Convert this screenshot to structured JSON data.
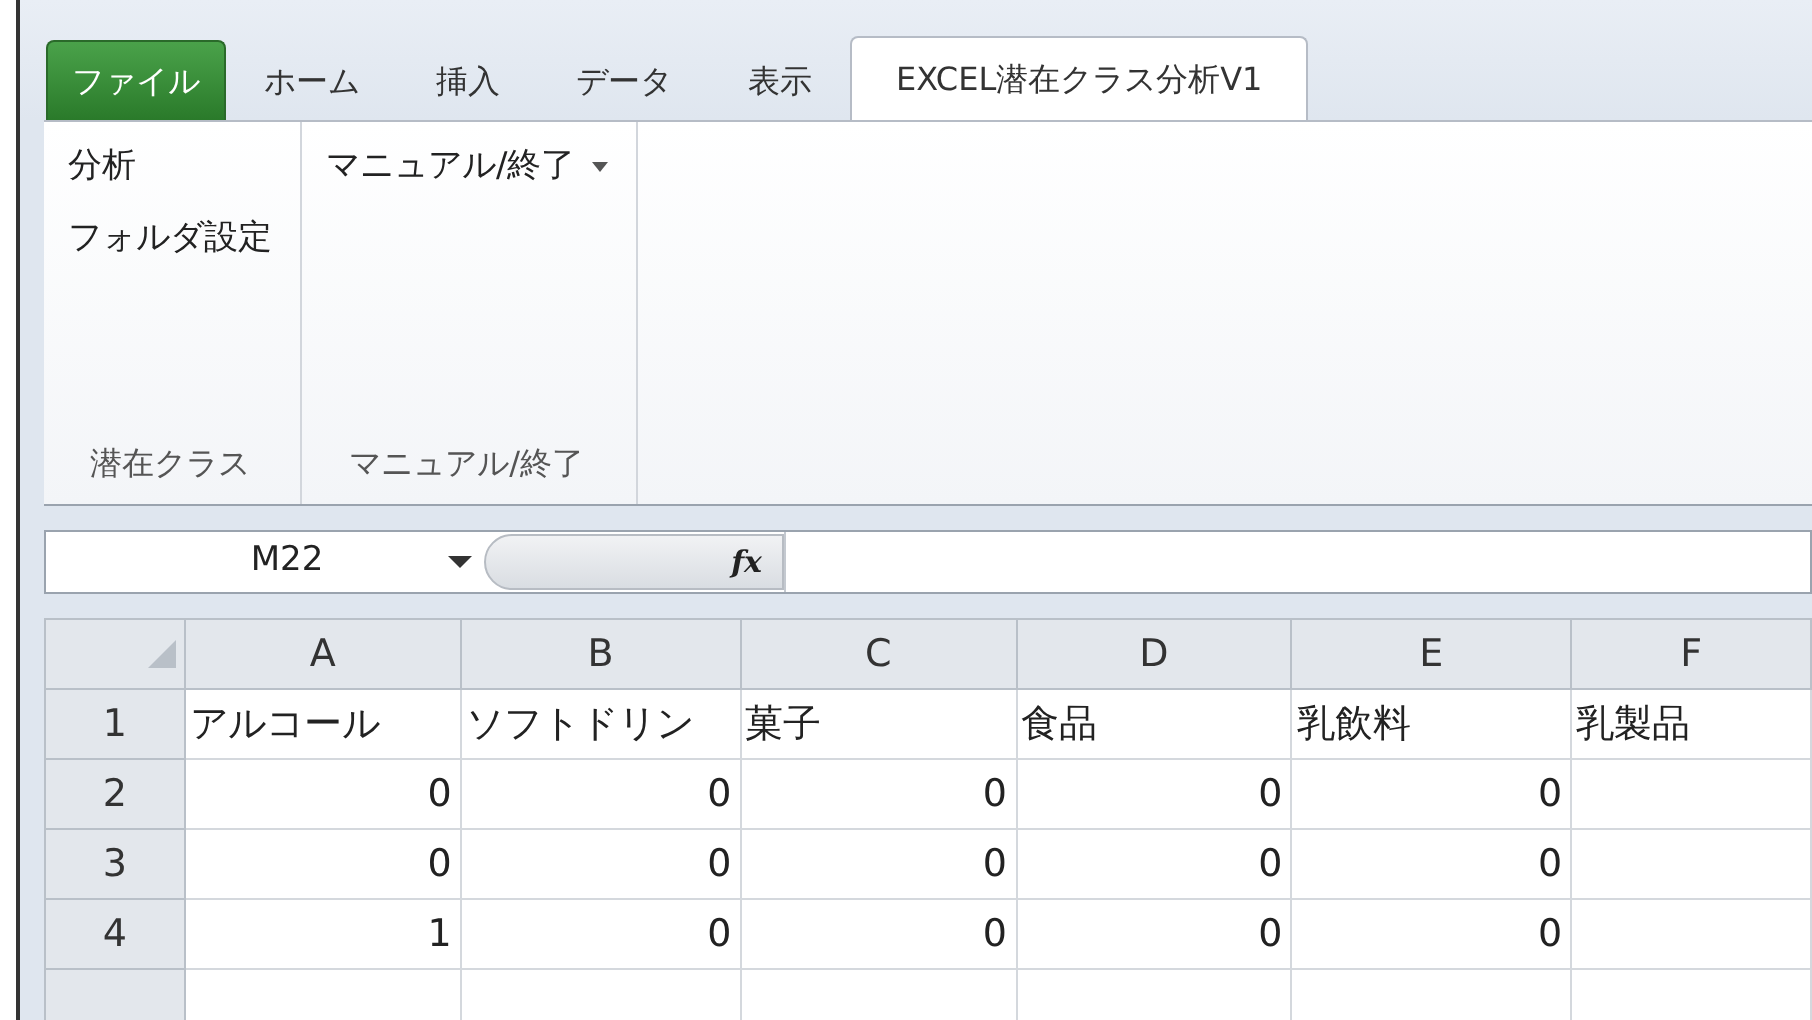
{
  "tabs": [
    {
      "label": "ファイル",
      "kind": "file",
      "selected": false
    },
    {
      "label": "ホーム",
      "kind": "tab",
      "selected": false
    },
    {
      "label": "挿入",
      "kind": "tab",
      "selected": false
    },
    {
      "label": "データ",
      "kind": "tab",
      "selected": false
    },
    {
      "label": "表示",
      "kind": "tab",
      "selected": false
    },
    {
      "label": "EXCEL潜在クラス分析V1",
      "kind": "tab",
      "selected": true
    }
  ],
  "ribbon_groups": [
    {
      "label": "潜在クラス",
      "items": [
        {
          "label": "分析",
          "dropdown": false
        },
        {
          "label": "フォルダ設定",
          "dropdown": false
        }
      ]
    },
    {
      "label": "マニュアル/終了",
      "items": [
        {
          "label": "マニュアル/終了",
          "dropdown": true
        }
      ]
    }
  ],
  "name_box": {
    "value": "M22"
  },
  "formula_bar": {
    "fx": "fx"
  },
  "sheet": {
    "columns": [
      "A",
      "B",
      "C",
      "D",
      "E",
      "F"
    ],
    "rows": [
      {
        "header": "1",
        "kind": "text",
        "cells": [
          "アルコール",
          "ソフトドリン",
          "菓子",
          "食品",
          "乳飲料",
          "乳製品"
        ]
      },
      {
        "header": "2",
        "kind": "number",
        "cells": [
          "0",
          "0",
          "0",
          "0",
          "0"
        ]
      },
      {
        "header": "3",
        "kind": "number",
        "cells": [
          "0",
          "0",
          "0",
          "0",
          "0"
        ]
      },
      {
        "header": "4",
        "kind": "number",
        "cells": [
          "1",
          "0",
          "0",
          "0",
          "0"
        ]
      }
    ]
  }
}
